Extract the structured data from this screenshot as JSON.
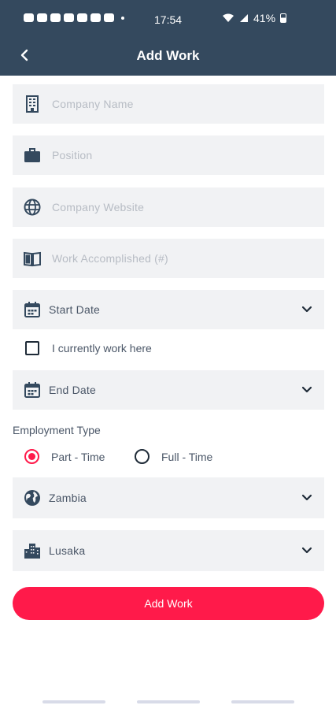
{
  "status_bar": {
    "time": "17:54",
    "battery": "41%"
  },
  "header": {
    "title": "Add Work",
    "back_icon": "chevron-left-icon"
  },
  "form": {
    "company_name": {
      "placeholder": "Company Name",
      "icon": "building-icon"
    },
    "position": {
      "placeholder": "Position",
      "icon": "briefcase-icon"
    },
    "company_website": {
      "placeholder": "Company Website",
      "icon": "globe-icon"
    },
    "work_accomplished": {
      "placeholder": "Work Accomplished (#)",
      "icon": "book-open-icon"
    },
    "start_date": {
      "label": "Start Date",
      "icon": "calendar-icon"
    },
    "currently_work_here": {
      "label": "I currently work here",
      "checked": false
    },
    "end_date": {
      "label": "End Date",
      "icon": "calendar-icon"
    },
    "employment_type": {
      "label": "Employment Type",
      "options": [
        "Part - Time",
        "Full - Time"
      ],
      "selected": "Part - Time"
    },
    "country": {
      "value": "Zambia",
      "icon": "earth-icon"
    },
    "city": {
      "value": "Lusaka",
      "icon": "city-icon"
    },
    "submit_label": "Add Work"
  },
  "colors": {
    "header_bg": "#34495e",
    "accent": "#ff1a4a",
    "field_bg": "#f1f2f4"
  }
}
